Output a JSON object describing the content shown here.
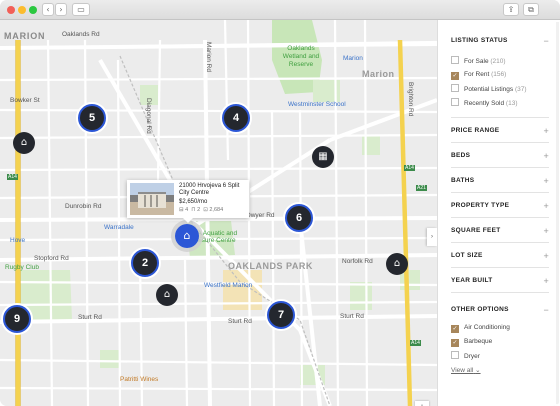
{
  "toolbar": {
    "back": "‹",
    "forward": "›",
    "sidebar": "▭",
    "share": "⇪",
    "tabs": "⧉"
  },
  "map": {
    "labels": {
      "marion_big": "MARION",
      "oaklands_park_area": "OAKLANDS PARK",
      "oaklands_rd": "Oaklands Rd",
      "wetland": "Oaklands Wetland and Reserve",
      "marion_station": "Marion",
      "marion_station_2": "Marion",
      "westminster": "Westminster School",
      "bowker": "Bowker St",
      "diagonal": "Diagonal Rd",
      "dunrobin": "Dunrobin Rd",
      "warradale": "Warradale",
      "sa_aquatic": "SA Aquatic and Leisure Centre",
      "dwyer": "Dwyer Rd",
      "norfolk": "Norfolk Rd",
      "stopford": "Stopford Rd",
      "hove": "Hove",
      "rugby": "Rugby Club",
      "westfield": "Westfield Marion",
      "sturt1": "Sturt Rd",
      "sturt2": "Sturt Rd",
      "sturt3": "Sturt Rd",
      "patritti": "Patritti Wines",
      "marion_rd": "Marion Rd",
      "brighton": "Brighton Rd",
      "a14": "A14",
      "a14b": "A14",
      "a14c": "A14",
      "a21": "A21"
    },
    "clusters": [
      "5",
      "4",
      "6",
      "2",
      "7",
      "9"
    ],
    "popup": {
      "title": "21000 Hrvojeva 6 Split City Centre",
      "price": "$2,650/mo",
      "beds": "4",
      "baths": "2",
      "sqft": "2,684"
    },
    "zoom_in": "+",
    "zoom_out": "−"
  },
  "sidebar": {
    "listing_status": {
      "title": "LISTING STATUS",
      "toggle": "−",
      "options": [
        {
          "label": "For Sale",
          "count": "(210)",
          "checked": false
        },
        {
          "label": "For Rent",
          "count": "(156)",
          "checked": true
        },
        {
          "label": "Potential Listings",
          "count": "(37)",
          "checked": false
        },
        {
          "label": "Recently Sold",
          "count": "(13)",
          "checked": false
        }
      ]
    },
    "sections": [
      {
        "title": "PRICE RANGE",
        "toggle": "+"
      },
      {
        "title": "BEDS",
        "toggle": "+"
      },
      {
        "title": "BATHS",
        "toggle": "+"
      },
      {
        "title": "PROPERTY TYPE",
        "toggle": "+"
      },
      {
        "title": "SQUARE FEET",
        "toggle": "+"
      },
      {
        "title": "LOT SIZE",
        "toggle": "+"
      },
      {
        "title": "YEAR BUILT",
        "toggle": "+"
      }
    ],
    "other_options": {
      "title": "OTHER OPTIONS",
      "toggle": "−",
      "options": [
        {
          "label": "Air Conditioning",
          "checked": true
        },
        {
          "label": "Barbeque",
          "checked": true
        },
        {
          "label": "Dryer",
          "checked": false
        }
      ],
      "view_all": "View all",
      "view_all_chevron": "⌄"
    }
  }
}
